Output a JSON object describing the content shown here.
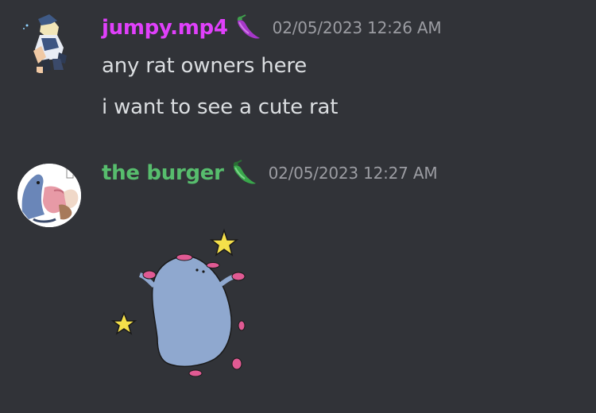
{
  "colors": {
    "background": "#313338",
    "message_text": "#dbdee1",
    "timestamp": "#9b9ca2"
  },
  "messages": [
    {
      "author": {
        "name": "jumpy.mp4",
        "color": "#e040fb",
        "role_icon": "purple-pepper-icon",
        "avatar": "anime-character-avatar"
      },
      "timestamp": "02/05/2023 12:26 AM",
      "lines": [
        "any rat owners here",
        "i want to see a cute rat"
      ]
    },
    {
      "author": {
        "name": "the burger",
        "color": "#57bd6d",
        "role_icon": "green-pepper-icon",
        "avatar": "creature-hug-avatar"
      },
      "timestamp": "02/05/2023 12:27 AM",
      "attachment": "dancing-rat-gif"
    }
  ]
}
